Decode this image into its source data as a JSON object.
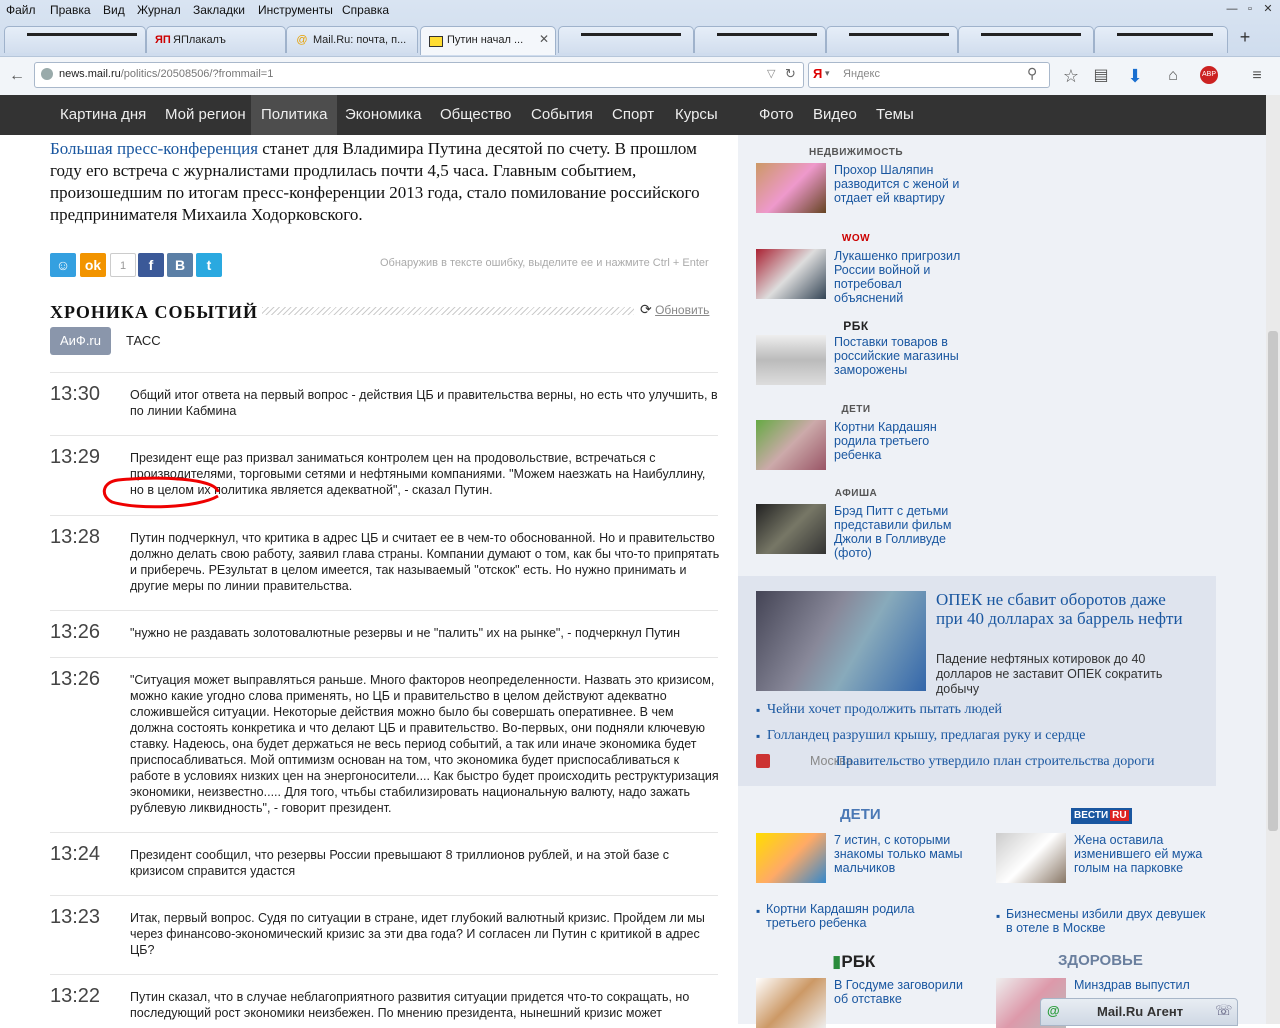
{
  "menu": [
    "Файл",
    "Правка",
    "Вид",
    "Журнал",
    "Закладки",
    "Инструменты",
    "Справка"
  ],
  "tabs": [
    {
      "label": "ЯПлакалъ"
    },
    {
      "label": "Mail.Ru: почта, п..."
    },
    {
      "label": "Путин начал ..."
    }
  ],
  "url": {
    "host": "news.mail.ru",
    "path": "/politics/20508506/?frommail=1"
  },
  "search_placeholder": "Яндекс",
  "abp": "ABP",
  "sitenav": [
    "Картина дня",
    "Мой регион",
    "Политика",
    "Экономика",
    "Общество",
    "События",
    "Спорт",
    "Курсы",
    "Фото",
    "Видео",
    "Темы"
  ],
  "lead": {
    "link": "Большая пресс-конференция",
    "rest": " станет для Владимира Путина десятой по счету. В прошлом году его встреча с журналистами продлилась почти 4,5 часа. Главным событием, произошедшим по итогам пресс-конференции 2013 года, стало помилование российского предпринимателя Михаила Ходорковского."
  },
  "share": {
    "count": "1",
    "error_hint": "Обнаружив в тексте ошибку, выделите ее и нажмите Ctrl + Enter"
  },
  "chronicle": {
    "title": "ХРОНИКА СОБЫТИЙ",
    "refresh": "Обновить",
    "sources": [
      "АиФ.ru",
      "ТАСС"
    ],
    "events": [
      {
        "time": "13:30",
        "text": "Общий итог ответа на первый вопрос - действия ЦБ и правительства верны, но есть что улучшить, в по линии Кабмина"
      },
      {
        "time": "13:29",
        "text": "Президент еще раз призвал заниматься контролем цен на продовольствие, встречаться с производителями, торговыми сетями и нефтяными компаниями. \"Можем наезжать на Наибуллину, но в целом их политика является адекватной\", - сказал Путин."
      },
      {
        "time": "13:28",
        "text": "Путин подчеркнул, что критика в адрес ЦБ и считает ее в чем-то обоснованной. Но и правительство должно делать свою работу, заявил глава страны. Компании думают о том, как бы что-то припрятать и приберечь. РЕзультат в целом имеется, так называемый \"отскок\" есть. Но нужно принимать и другие меры по линии правительства."
      },
      {
        "time": "13:26",
        "text": "\"нужно не раздавать золотовалютные резервы и не \"палить\" их на рынке\", - подчеркнул Путин"
      },
      {
        "time": "13:26",
        "text": "\"Ситуация может выправляться раньше. Много факторов неопределенности. Назвать это кризисом, можно какие угодно слова применять, но ЦБ и правительство в целом действуют адекватно сложившейся ситуации. Некоторые действия можно было бы совершать оперативнее. В чем должна состоять конкретика и что делают ЦБ и правительство. Во-первых, они подняли ключевую ставку. Надеюсь, она будет держаться не весь период событий, а так или иначе экономика будет приспосабливаться. Мой оптимизм основан на том, что экономика будет приспосабливаться к работе в условиях низких цен на энергоносители.... Как быстро будет происходить реструктуризация экономики, неизвестно..... Для того, чтьбы стабилизировать национальную валюту, надо зажать рублевую ликвидность\", - говорит президент."
      },
      {
        "time": "13:24",
        "text": "Президент сообщил, что резервы России превышают 8 триллионов рублей, и на этой базе с кризисом справится удастся"
      },
      {
        "time": "13:23",
        "text": "Итак, первый вопрос. Судя по ситуации в стране, идет глубокий валютный кризис. Пройдем ли мы через финансово-экономический кризис за эти два года? И согласен ли Путин с критикой в адрес ЦБ?"
      },
      {
        "time": "13:22",
        "text": "Путин сказал, что в случае неблагоприятного развития ситуации придется что-то сокращать, но последующий рост экономики неизбежен. По мнению президента, нынешний кризис может"
      }
    ]
  },
  "sidebar": {
    "items": [
      {
        "cat": "НЕДВИЖИМОСТЬ",
        "text": "Прохор Шаляпин разводится с женой и отдает ей квартиру"
      },
      {
        "cat": "WOW",
        "text": "Лукашенко пригрозил России войной и потребовал объяснений"
      },
      {
        "cat": "РБК",
        "text": "Поставки товаров в российские магазины заморожены"
      },
      {
        "cat": "ДЕТИ",
        "text": "Кортни Кардашян родила третьего ребенка"
      },
      {
        "cat": "АФИША",
        "text": "Брэд Питт с детьми представили фильм Джоли в Голливуде (фото)"
      }
    ],
    "feature": {
      "headline": "ОПЕК не сбавит оборотов даже при 40 долларах за баррель нефти",
      "sub": "Падение нефтяных котировок до 40 долларов не заставит ОПЕК сократить добычу",
      "links": [
        "Чейни хочет продолжить пытать людей",
        "Голландец разрушил крышу, предлагая руку и сердце"
      ],
      "moscow_label": "Москва",
      "moscow_link": "Правительство утвердило план строительства дороги"
    },
    "blocks": {
      "deti": {
        "title": "ДЕТИ",
        "item": "7 истин, с которыми знакомы только мамы мальчиков",
        "link": "Кортни Кардашян родила третьего ребенка"
      },
      "vesti": {
        "badge": "ВЕСТИ",
        "badge2": "RU",
        "item": "Жена оставила изменившего ей мужа голым на парковке",
        "link": "Бизнесмены избили двух девушек в отеле в Москве"
      },
      "rbk": {
        "badge": "РБК",
        "item": "В Госдуме заговорили об отставке"
      },
      "zdorovie": {
        "title": "ЗДОРОВЬЕ",
        "item": "Минздрав выпустил"
      }
    }
  },
  "agent": "Mail.Ru Агент"
}
